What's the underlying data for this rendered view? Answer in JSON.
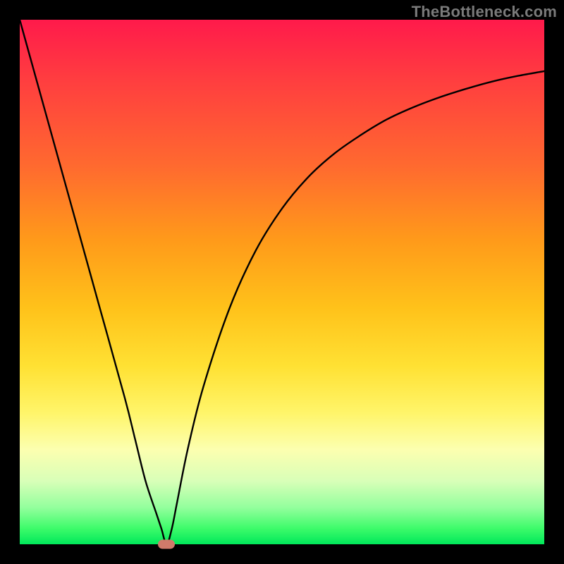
{
  "watermark": "TheBottleneck.com",
  "chart_data": {
    "type": "line",
    "title": "",
    "xlabel": "",
    "ylabel": "",
    "xlim": [
      0,
      100
    ],
    "ylim": [
      0,
      100
    ],
    "series": [
      {
        "name": "curve",
        "x": [
          0,
          5,
          10,
          15,
          20,
          22,
          24,
          26,
          27,
          28,
          29,
          30,
          32,
          35,
          40,
          45,
          50,
          55,
          60,
          65,
          70,
          75,
          80,
          85,
          90,
          95,
          100
        ],
        "y": [
          100,
          82,
          64,
          46,
          28,
          20,
          12,
          6,
          3,
          0,
          3,
          8,
          18,
          30,
          45,
          56,
          64,
          70,
          74.5,
          78,
          81,
          83.3,
          85.2,
          86.8,
          88.2,
          89.3,
          90.2
        ]
      }
    ],
    "marker": {
      "x": 28,
      "y": 0,
      "color": "#d07a6a"
    },
    "gradient_stops": [
      {
        "pos": 0,
        "color": "#ff1a4b"
      },
      {
        "pos": 12,
        "color": "#ff3f3f"
      },
      {
        "pos": 28,
        "color": "#ff6a2f"
      },
      {
        "pos": 42,
        "color": "#ff9a1a"
      },
      {
        "pos": 55,
        "color": "#ffc21a"
      },
      {
        "pos": 66,
        "color": "#ffe133"
      },
      {
        "pos": 75,
        "color": "#fff56a"
      },
      {
        "pos": 82,
        "color": "#fcffb0"
      },
      {
        "pos": 88,
        "color": "#d8ffb8"
      },
      {
        "pos": 93,
        "color": "#93ff9d"
      },
      {
        "pos": 97,
        "color": "#3dfb6a"
      },
      {
        "pos": 100,
        "color": "#00e85a"
      }
    ]
  }
}
